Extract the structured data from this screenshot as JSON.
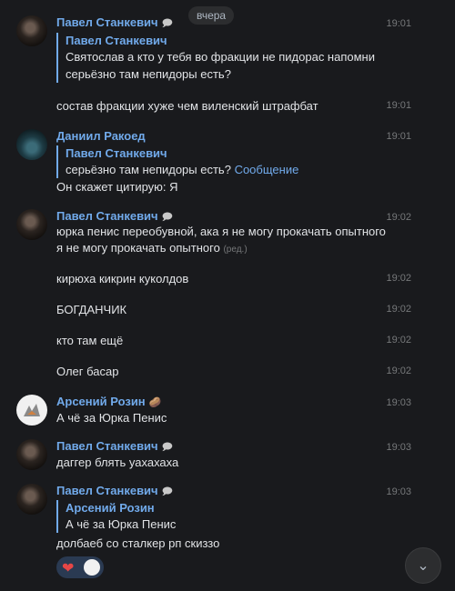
{
  "date_separator": "вчера",
  "messages": [
    {
      "author": "Павел Станкевич",
      "emoji": "🗩",
      "time": "19:01",
      "reply": {
        "author": "Павел Станкевич",
        "text1": "Святослав а кто у тебя во фракции не пидорас напомни",
        "text2": "серьёзно там непидоры есть?"
      }
    },
    {
      "time": "19:01",
      "text": "состав фракции хуже чем виленский штрафбат"
    },
    {
      "author": "Даниил Ракоед",
      "time": "19:01",
      "reply": {
        "author": "Павел Станкевич",
        "text": "серьёзно там непидоры есть?",
        "link": "Сообщение"
      },
      "text": "Он скажет цитирую: Я"
    },
    {
      "author": "Павел Станкевич",
      "emoji": "🗩",
      "time": "19:02",
      "text1": "юрка пенис переобувной, ака я не могу прокачать опытного",
      "text2": "я не могу прокачать опытного",
      "edited": "(ред.)"
    },
    {
      "time": "19:02",
      "text": "кирюха кикрин куколдов"
    },
    {
      "time": "19:02",
      "text": "БОГДАНЧИК"
    },
    {
      "time": "19:02",
      "text": "кто там ещё"
    },
    {
      "time": "19:02",
      "text": "Олег басар"
    },
    {
      "author": "Арсений Розин",
      "emoji": "🥔",
      "time": "19:03",
      "text": "А чё за Юрка Пенис"
    },
    {
      "author": "Павел Станкевич",
      "emoji": "🗩",
      "time": "19:03",
      "text": "даггер блять уахахаха"
    },
    {
      "author": "Павел Станкевич",
      "emoji": "🗩",
      "time": "19:03",
      "reply": {
        "author": "Арсений Розин",
        "text": "А чё за Юрка Пенис"
      },
      "text": "долбаеб со сталкер рп скиззо"
    }
  ],
  "reactions": {
    "emoji": "❤"
  },
  "scroll_button": {
    "icon": "⌄"
  }
}
